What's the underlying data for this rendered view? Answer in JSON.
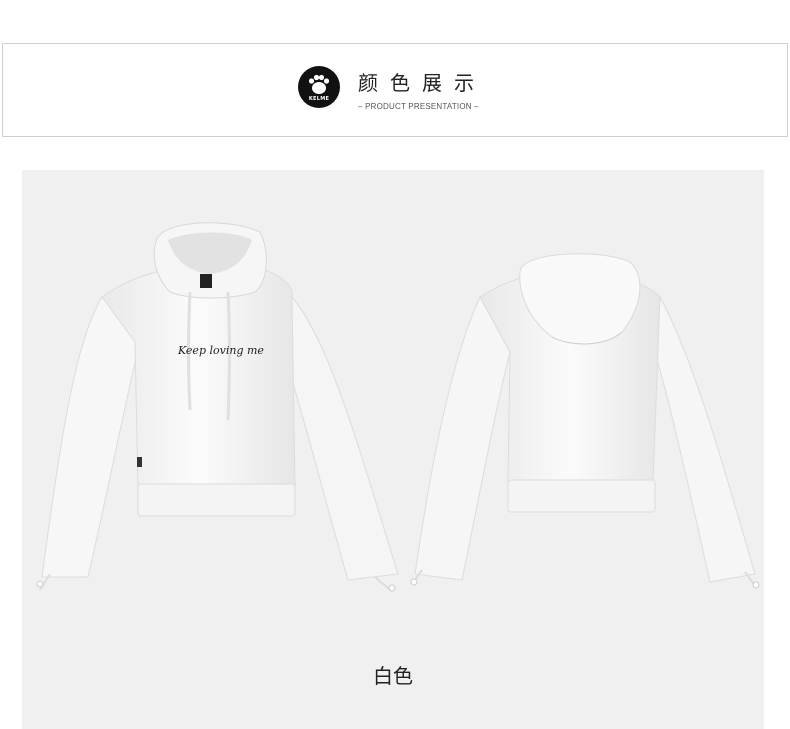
{
  "header": {
    "logo_text": "KELME",
    "title": "颜色展示",
    "subtitle": "– PRODUCT PRESENTATION –"
  },
  "product": {
    "front_print": "Keep loving me",
    "color_label": "白色"
  }
}
